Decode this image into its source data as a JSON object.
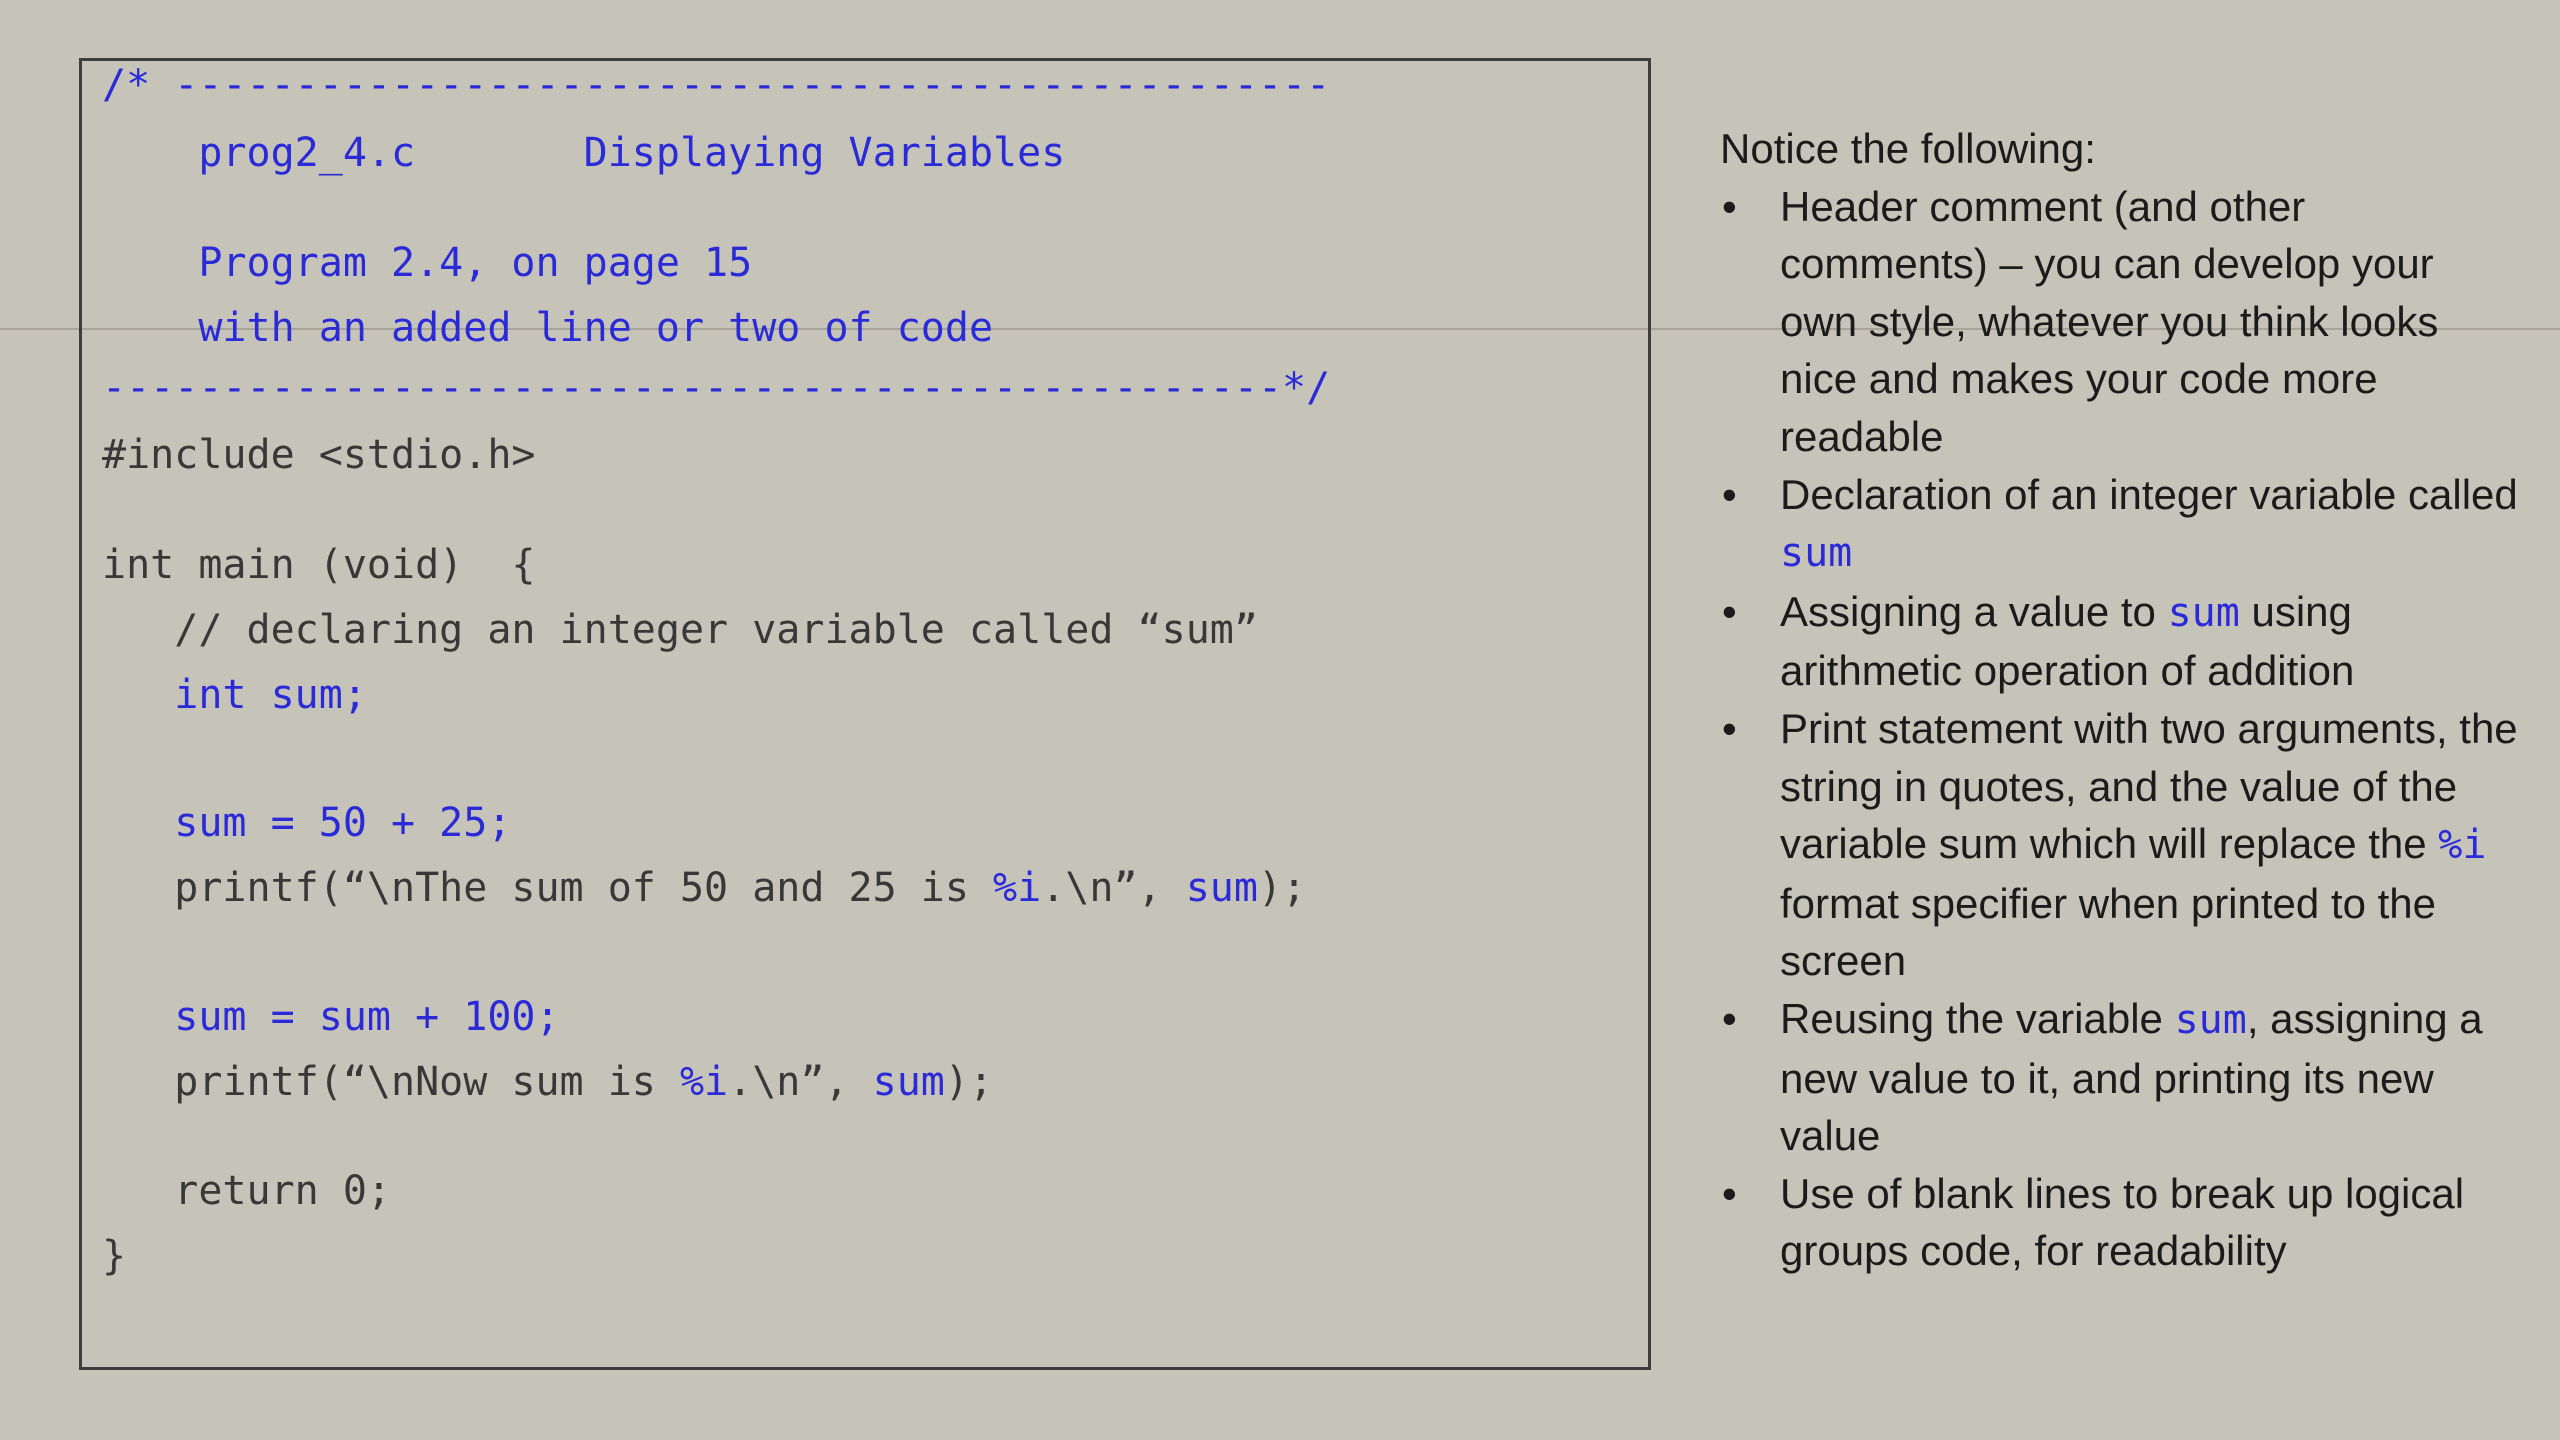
{
  "code": {
    "lines": [
      [
        {
          "t": "/* ------------------------------------------------",
          "c": "blue"
        }
      ],
      [
        {
          "t": "    prog2_4.c       Displaying Variables",
          "c": "blue"
        }
      ],
      [
        {
          "t": "    Program 2.4, on page 15",
          "c": "blue"
        }
      ],
      [
        {
          "t": "    with an added line or two of code",
          "c": "blue"
        }
      ],
      [
        {
          "t": "-------------------------------------------------*/",
          "c": "blue"
        }
      ],
      [
        {
          "t": "#include <stdio.h>",
          "c": "dark"
        }
      ],
      [
        {
          "t": "int main (void)  {",
          "c": "dark"
        }
      ],
      [
        {
          "t": "   // declaring an integer variable called “sum”",
          "c": "dark"
        }
      ],
      [
        {
          "t": "   int sum;",
          "c": "blue"
        }
      ],
      [
        {
          "t": "   sum = 50 + 25;",
          "c": "blue"
        }
      ],
      [
        {
          "t": "   printf(“\\nThe sum of 50 and 25 is ",
          "c": "dark"
        },
        {
          "t": "%i",
          "c": "blue"
        },
        {
          "t": ".\\n”, ",
          "c": "dark"
        },
        {
          "t": "sum",
          "c": "blue"
        },
        {
          "t": ");",
          "c": "dark"
        }
      ],
      [
        {
          "t": "   sum = sum + 100;",
          "c": "blue"
        }
      ],
      [
        {
          "t": "   printf(“\\nNow sum is ",
          "c": "dark"
        },
        {
          "t": "%i",
          "c": "blue"
        },
        {
          "t": ".\\n”, ",
          "c": "dark"
        },
        {
          "t": "sum",
          "c": "blue"
        },
        {
          "t": ");",
          "c": "dark"
        }
      ],
      [
        {
          "t": "   return 0;",
          "c": "dark"
        }
      ],
      [
        {
          "t": "}",
          "c": "dark"
        }
      ]
    ]
  },
  "notes": {
    "title": "Notice the following:",
    "bullet_glyph": "•",
    "bullets": [
      [
        {
          "t": "Header comment (and other comments) – you can develop your own style, whatever you think looks nice and makes your code more readable"
        }
      ],
      [
        {
          "t": "Declaration of an integer variable called "
        },
        {
          "t": "sum",
          "code": true
        }
      ],
      [
        {
          "t": "Assigning a value to "
        },
        {
          "t": "sum",
          "code": true
        },
        {
          "t": " using arithmetic operation of addition"
        }
      ],
      [
        {
          "t": "Print statement with two arguments, the string in quotes, and the value of the variable sum which will replace the "
        },
        {
          "t": "%i",
          "code": true
        },
        {
          "t": " format specifier when printed to the screen"
        }
      ],
      [
        {
          "t": "Reusing the variable "
        },
        {
          "t": "sum",
          "code": true
        },
        {
          "t": ", assigning a new value to it, and printing its new value"
        }
      ],
      [
        {
          "t": "Use of blank lines to break up logical groups code, for readability"
        }
      ]
    ]
  }
}
